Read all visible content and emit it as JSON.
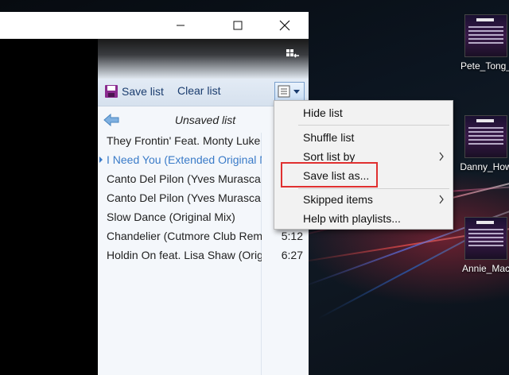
{
  "window": {
    "titlebar_buttons": [
      "minimize",
      "maximize",
      "close"
    ],
    "toolbar": {
      "save_list": "Save list",
      "clear_list": "Clear list"
    },
    "list": {
      "title": "Unsaved list",
      "tracks": [
        {
          "name": "They Frontin' Feat. Monty Luke",
          "duration": ""
        },
        {
          "name": "I Need You (Extended Original Mix)",
          "duration": "",
          "playing": true
        },
        {
          "name": "Canto Del Pilon (Yves Murasca Remix)",
          "duration": ""
        },
        {
          "name": "Canto Del Pilon (Yves Murasca Remix)",
          "duration": ""
        },
        {
          "name": "Slow Dance (Original Mix)",
          "duration": ""
        },
        {
          "name": "Chandelier (Cutmore Club Remix)",
          "duration": "5:12"
        },
        {
          "name": "Holdin On feat. Lisa Shaw (Original Mix)",
          "duration": "6:27"
        }
      ]
    }
  },
  "menu": {
    "items": [
      {
        "label": "Hide list",
        "submenu": false
      },
      {
        "label": "Shuffle list",
        "submenu": false
      },
      {
        "label": "Sort list by",
        "submenu": true
      },
      {
        "label": "Save list as...",
        "submenu": false,
        "highlighted": true
      },
      {
        "label": "Skipped items",
        "submenu": true
      },
      {
        "label": "Help with playlists...",
        "submenu": false
      }
    ]
  },
  "desktop": {
    "icons": [
      {
        "label": "Pete_Tong_"
      },
      {
        "label": "Danny_How"
      },
      {
        "label": "Annie_Mac"
      }
    ]
  },
  "colors": {
    "accent": "#3a7bc8",
    "highlight_box": "#e03030",
    "toolbar_text": "#1a3c6e"
  }
}
